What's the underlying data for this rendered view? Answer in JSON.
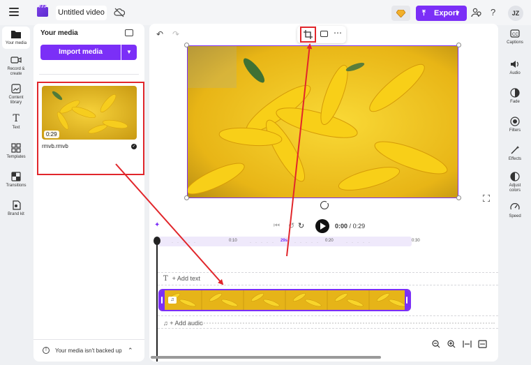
{
  "topbar": {
    "title": "Untitled video",
    "export_label": "Export",
    "avatar_initials": "JZ",
    "help_label": "?"
  },
  "left_rail": {
    "items": [
      {
        "label": "Your media"
      },
      {
        "label": "Record &\ncreate"
      },
      {
        "label": "Content\nlibrary"
      },
      {
        "label": "Text"
      },
      {
        "label": "Templates"
      },
      {
        "label": "Transitions"
      },
      {
        "label": "Brand kit"
      }
    ]
  },
  "media_panel": {
    "title": "Your media",
    "import_label": "Import media",
    "item": {
      "name": "rmvb.rmvb",
      "duration": "0:29"
    },
    "backup_text": "Your media isn't backed up"
  },
  "player": {
    "current_time": "0:00",
    "separator": "/",
    "total_time": "0:29"
  },
  "timeline": {
    "ticks": [
      {
        "label": "0:10"
      },
      {
        "label": "29s"
      },
      {
        "label": "0:20"
      },
      {
        "label": "0:30"
      }
    ],
    "add_text": "+ Add text",
    "add_audio": "+ Add audio"
  },
  "right_rail": {
    "items": [
      {
        "label": "Captions"
      },
      {
        "label": "Audio"
      },
      {
        "label": "Fade"
      },
      {
        "label": "Filters"
      },
      {
        "label": "Effects"
      },
      {
        "label": "Adjust\ncolors"
      },
      {
        "label": "Speed"
      }
    ]
  },
  "colors": {
    "accent": "#7b2ff7",
    "annotation": "#e1262b",
    "clip_yellow": "#e8b91c"
  }
}
